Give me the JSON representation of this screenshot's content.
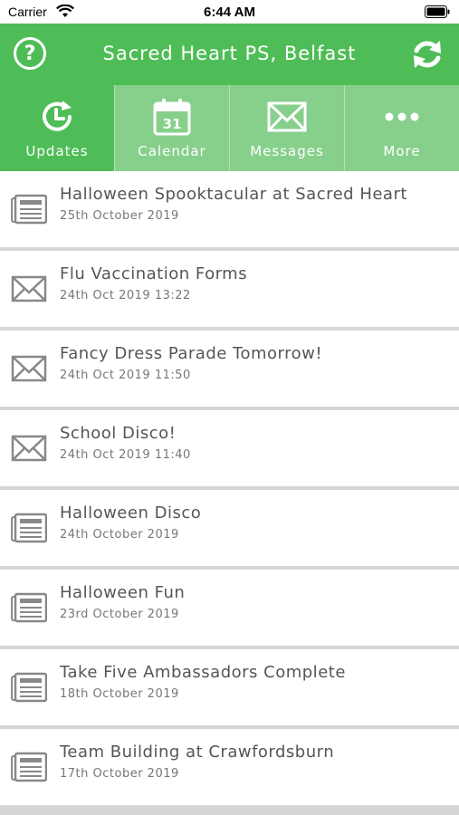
{
  "status_bar": {
    "carrier": "Carrier",
    "time": "6:44 AM"
  },
  "header": {
    "title": "Sacred Heart PS, Belfast",
    "help_symbol": "?",
    "help_icon": "question-circle-icon",
    "refresh_icon": "refresh-icon"
  },
  "tabs": [
    {
      "label": "Updates",
      "icon": "updates-clock-icon",
      "active": true
    },
    {
      "label": "Calendar",
      "icon": "calendar-icon",
      "calendar_day": "31",
      "active": false
    },
    {
      "label": "Messages",
      "icon": "envelope-icon",
      "active": false
    },
    {
      "label": "More",
      "icon": "more-dots-icon",
      "active": false
    }
  ],
  "items": [
    {
      "title": "Halloween Spooktacular at Sacred Heart",
      "date": "25th October 2019",
      "icon": "newspaper-icon"
    },
    {
      "title": "Flu Vaccination Forms",
      "date": "24th Oct 2019 13:22",
      "icon": "envelope-icon"
    },
    {
      "title": "Fancy Dress Parade Tomorrow!",
      "date": "24th Oct 2019 11:50",
      "icon": "envelope-icon"
    },
    {
      "title": "School Disco!",
      "date": "24th Oct 2019 11:40",
      "icon": "envelope-icon"
    },
    {
      "title": "Halloween Disco",
      "date": "24th October 2019",
      "icon": "newspaper-icon"
    },
    {
      "title": "Halloween Fun",
      "date": "23rd October 2019",
      "icon": "newspaper-icon"
    },
    {
      "title": "Take Five Ambassadors Complete",
      "date": "18th October 2019",
      "icon": "newspaper-icon"
    },
    {
      "title": "Team Building at Crawfordsburn",
      "date": "17th October 2019",
      "icon": "newspaper-icon"
    }
  ],
  "colors": {
    "brand_green": "#4fbd57",
    "tab_inactive": "#87d08c",
    "list_separator": "#d6d6d6",
    "text_title": "#555555",
    "text_date": "#777777"
  }
}
